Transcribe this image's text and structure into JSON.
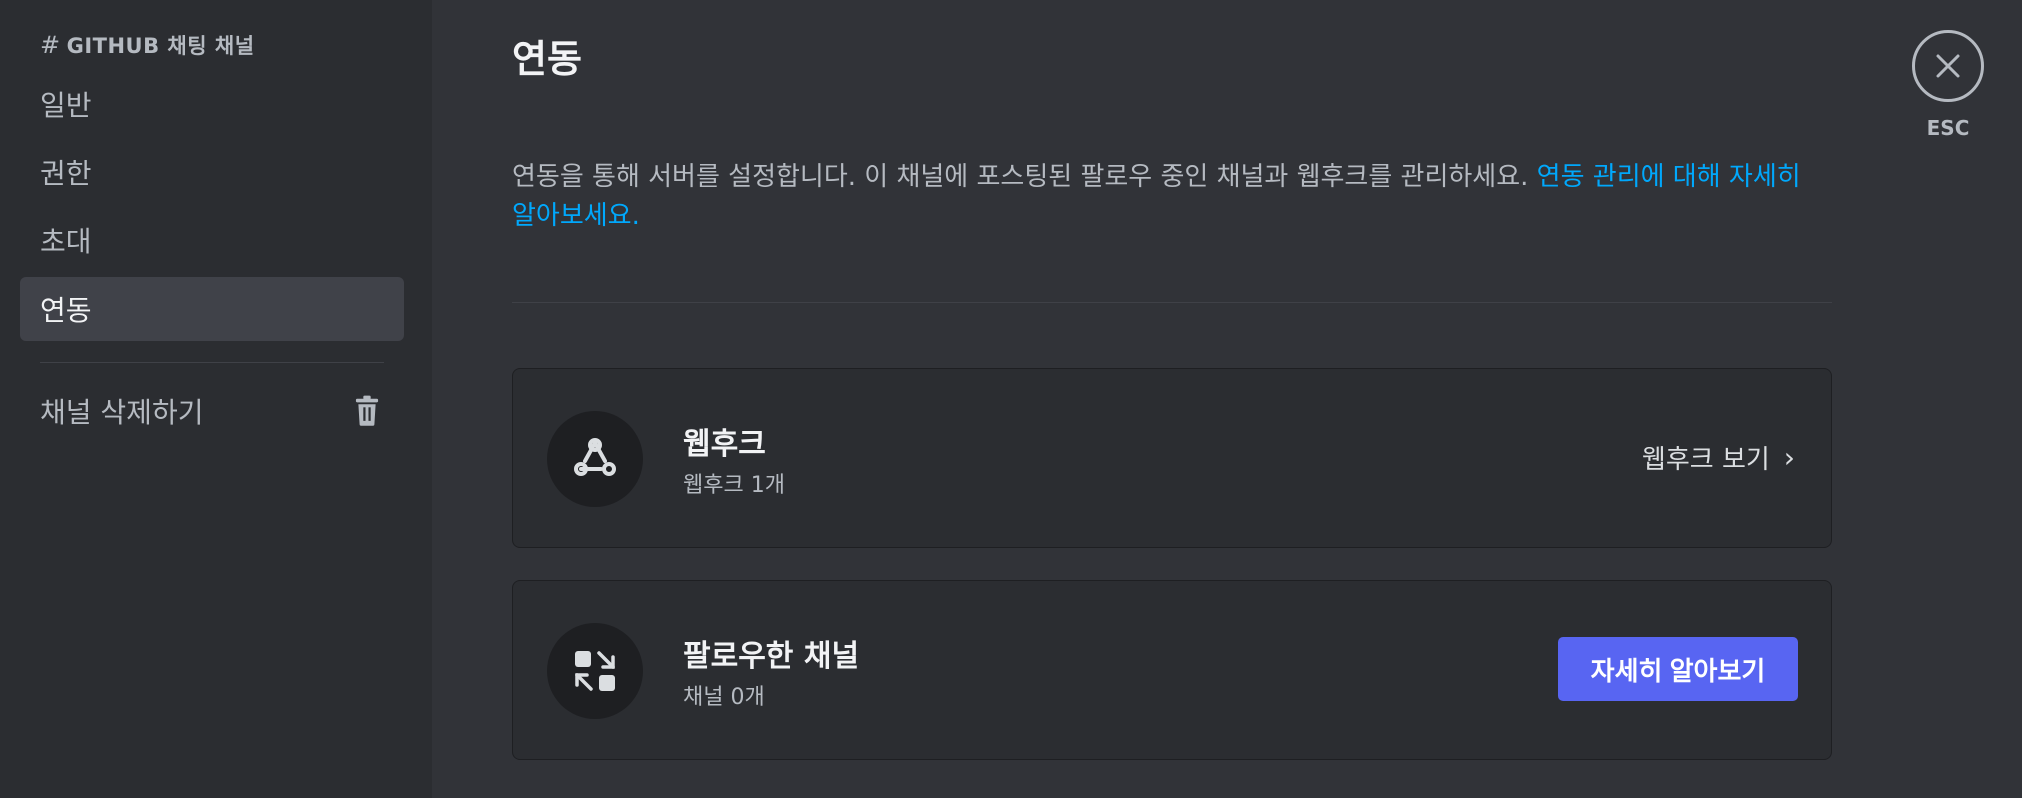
{
  "sidebar": {
    "header_hash": "#",
    "header": "GITHUB 채팅 채널",
    "items": [
      {
        "label": "일반"
      },
      {
        "label": "권한"
      },
      {
        "label": "초대"
      },
      {
        "label": "연동"
      }
    ],
    "delete_label": "채널 삭제하기"
  },
  "main": {
    "title": "연동",
    "description": "연동을 통해 서버를 설정합니다. 이 채널에 포스팅된 팔로우 중인 채널과 웹후크를 관리하세요.",
    "description_link": "연동 관리에 대해 자세히 알아보세요.",
    "webhooks": {
      "title": "웹후크",
      "subtitle": "웹후크 1개",
      "action": "웹후크 보기",
      "chevron": "›"
    },
    "followed": {
      "title": "팔로우한 채널",
      "subtitle": "채널 0개",
      "action": "자세히 알아보기"
    }
  },
  "close": {
    "label": "ESC"
  },
  "colors": {
    "accent": "#5865f2",
    "link": "#00a8fc",
    "sidebar_bg": "#2b2d31",
    "main_bg": "#313338"
  }
}
